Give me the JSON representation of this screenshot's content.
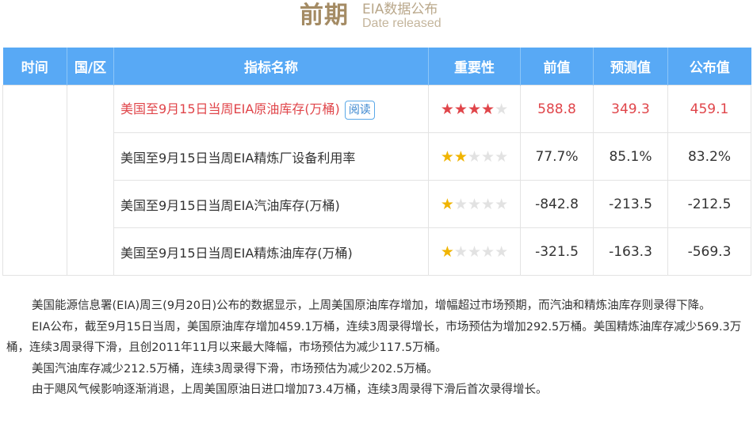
{
  "header": {
    "title": "前期",
    "subtitle_cn": "EIA数据公布",
    "subtitle_en": "Date released"
  },
  "table": {
    "columns": [
      "时间",
      "国/区",
      "指标名称",
      "重要性",
      "前值",
      "预测值",
      "公布值"
    ],
    "rows": [
      {
        "name": "美国至9月15日当周EIA原油库存(万桶)",
        "badge": "阅读",
        "stars": 4,
        "highlight": true,
        "prev": "588.8",
        "forecast": "349.3",
        "actual": "459.1"
      },
      {
        "name": "美国至9月15日当周EIA精炼厂设备利用率",
        "badge": "",
        "stars": 2,
        "highlight": false,
        "prev": "77.7%",
        "forecast": "85.1%",
        "actual": "83.2%"
      },
      {
        "name": "美国至9月15日当周EIA汽油库存(万桶)",
        "badge": "",
        "stars": 1,
        "highlight": false,
        "prev": "-842.8",
        "forecast": "-213.5",
        "actual": "-212.5"
      },
      {
        "name": "美国至9月15日当周EIA精炼油库存(万桶)",
        "badge": "",
        "stars": 1,
        "highlight": false,
        "prev": "-321.5",
        "forecast": "-163.3",
        "actual": "-569.3"
      }
    ]
  },
  "article": {
    "paragraphs": [
      "美国能源信息署(EIA)周三(9月20日)公布的数据显示，上周美国原油库存增加，增幅超过市场预期，而汽油和精炼油库存则录得下降。",
      "EIA公布，截至9月15日当周，美国原油库存增加459.1万桶，连续3周录得增长，市场预估为增加292.5万桶。美国精炼油库存减少569.3万桶，连续3周录得下滑，且创2011年11月以来最大降幅，市场预估为减少117.5万桶。",
      "美国汽油库存减少212.5万桶，连续3周录得下滑，市场预估为减少202.5万桶。",
      "由于飓风气候影响逐渐消退，上周美国原油日进口增加73.4万桶，连续3周录得下滑后首次录得增长。"
    ]
  },
  "colors": {
    "header_bg": "#58a9f5",
    "highlight_red": "#e0454a",
    "star_gold": "#f0b400",
    "title_gold": "#a48b64"
  }
}
